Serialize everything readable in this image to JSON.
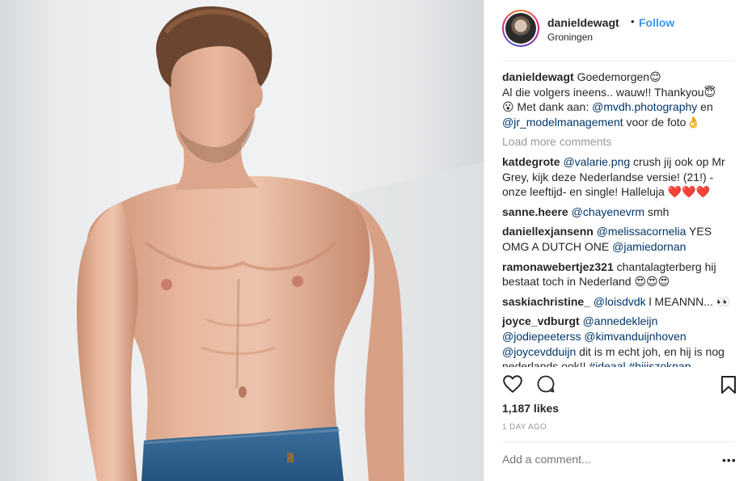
{
  "header": {
    "username": "danieldewagt",
    "separator": "•",
    "follow_label": "Follow",
    "location": "Groningen"
  },
  "caption": {
    "username": "danieldewagt",
    "line1": "Goedemorgen😊",
    "line2": "Al die volgers ineens.. wauw!! Thankyou😇",
    "line3_a": "😮 Met dank aan: ",
    "mention1": "@mvdh.photography",
    "line3_b": " en",
    "mention2": "@jr_modelmanagement",
    "line4_b": " voor de foto👌"
  },
  "load_more": "Load more comments",
  "comments": [
    {
      "user": "katdegrote",
      "mention": "@valarie.png",
      "text": " crush jij ook op Mr Grey, kijk deze Nederlandse versie! (21!) - onze leeftijd- en single! Halleluja ❤️❤️❤️"
    },
    {
      "user": "sanne.heere",
      "mention": "@chayenevrm",
      "text": " smh"
    },
    {
      "user": "daniellexjansenn",
      "mention": "@melissacornelia",
      "text": " YES OMG A DUTCH ONE ",
      "mention2": "@jamiedornan"
    },
    {
      "user": "ramonawebertjez321",
      "text": " chantalagterberg hij bestaat toch in Nederland 😍😍😍"
    },
    {
      "user": "saskiachristine_",
      "mention": "@loisdvdk",
      "text": " l MEANNN... 👀"
    },
    {
      "user": "joyce_vdburgt",
      "mention": "@annedekleijn",
      "mention2": "@jodiepeeterss",
      "mention3": "@kimvanduijnhoven",
      "mention4": "@joycevdduijn",
      "text": " dit is m echt joh, en hij is nog nederlands ook!! ",
      "tag1": "#ideaal",
      "tag2": "#hijiszoknap"
    }
  ],
  "icons": {
    "like": "heart-icon",
    "comment": "comment-bubble-icon",
    "save": "bookmark-icon"
  },
  "likes": "1,187 likes",
  "time": "1 DAY AGO",
  "add_comment_placeholder": "Add a comment...",
  "more_label": "•••",
  "colors": {
    "link_blue": "#3897f0",
    "mention_blue": "#003569",
    "muted_gray": "#999999",
    "text": "#262626"
  }
}
